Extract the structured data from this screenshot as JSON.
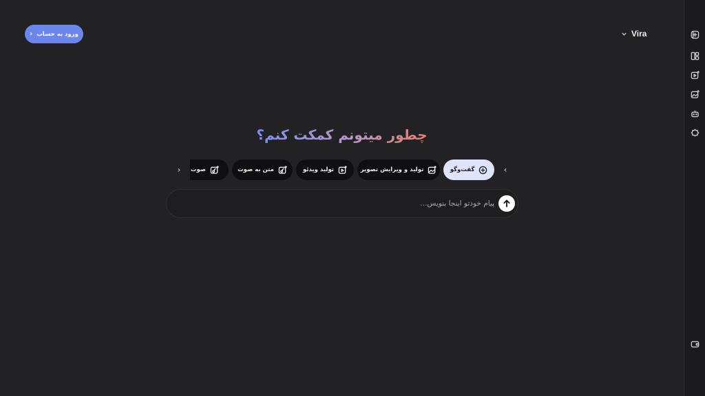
{
  "header": {
    "login_label": "ورود به حساب",
    "model_name": "Vira"
  },
  "main": {
    "heading": "چطور میتونم کمکت کنم؟",
    "chips": [
      {
        "label": "گفت‌وگو",
        "icon": "chat-plus-icon",
        "active": true
      },
      {
        "label": "تولید و ویرایش تصویر",
        "icon": "image-sparkle-icon"
      },
      {
        "label": "تولید ویدئو",
        "icon": "video-sparkle-icon"
      },
      {
        "label": "متن به صوت",
        "icon": "mic-sparkle-icon"
      },
      {
        "label": "صوت به متن",
        "icon": "audio-sparkle-icon"
      }
    ],
    "input_placeholder": "پیام خودتو اینجا بنویس..."
  },
  "rail": {
    "icons": [
      "new-chat-icon",
      "layout-icon",
      "video-icon",
      "image-icon",
      "bot-icon",
      "badge-star-icon",
      "wallet-icon"
    ]
  }
}
